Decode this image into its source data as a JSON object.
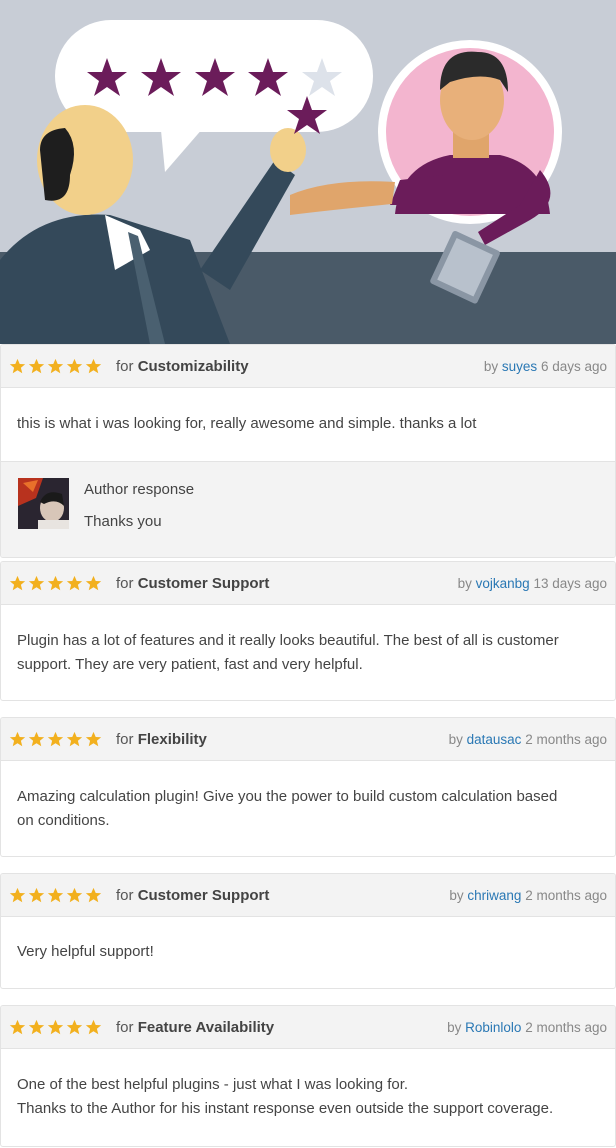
{
  "colors": {
    "star": "#f2b01e",
    "link": "#2a78b4",
    "header_bg": "#f3f3f3",
    "hero_sky": "#c8cdd6",
    "hero_floor": "#4a5a68",
    "purple": "#6b1c5a"
  },
  "hero": {
    "rating_stars_filled": 4,
    "rating_stars_total": 5,
    "icon": "rating-handshake-illustration"
  },
  "reviews": [
    {
      "rating": 5,
      "for_label": "for",
      "category": "Customizability",
      "by_label": "by",
      "user": "suyes",
      "time": "6 days ago",
      "body": "this is what i was looking for, really awesome and simple. thanks a lot",
      "author_response": {
        "title": "Author response",
        "text": "Thanks you"
      }
    },
    {
      "rating": 5,
      "for_label": "for",
      "category": "Customer Support",
      "by_label": "by",
      "user": "vojkanbg",
      "time": "13 days ago",
      "body_lines": [
        "Plugin has a lot of features and it really looks beautiful. The best of all is customer",
        "support. They are very patient, fast and very helpful."
      ]
    },
    {
      "rating": 5,
      "for_label": "for",
      "category": "Flexibility",
      "by_label": "by",
      "user": "datausac",
      "time": "2 months ago",
      "body_lines": [
        "Amazing calculation plugin! Give you the power to build custom calculation based",
        "on conditions."
      ]
    },
    {
      "rating": 5,
      "for_label": "for",
      "category": "Customer Support",
      "by_label": "by",
      "user": "chriwang",
      "time": "2 months ago",
      "body": "Very helpful support!"
    },
    {
      "rating": 5,
      "for_label": "for",
      "category": "Feature Availability",
      "by_label": "by",
      "user": "Robinlolo",
      "time": "2 months ago",
      "body_lines": [
        "One of the best helpful plugins - just what I was looking for.",
        "Thanks to the Author for his instant response even outside the support coverage."
      ]
    }
  ]
}
